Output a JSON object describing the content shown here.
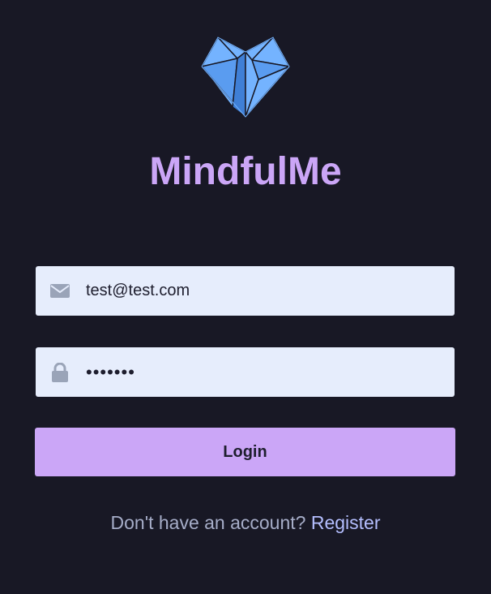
{
  "app": {
    "title": "MindfulMe",
    "logo_icon": "geometric-heart-icon"
  },
  "form": {
    "email": {
      "value": "test@test.com",
      "icon": "envelope-icon"
    },
    "password": {
      "value": "•••••••",
      "icon": "lock-icon"
    },
    "login_label": "Login"
  },
  "footer": {
    "prompt": "Don't have an account?",
    "register_label": "Register"
  },
  "colors": {
    "background": "#181825",
    "accent": "#cba6f7",
    "input_bg": "#e6edfc",
    "link": "#b4befe",
    "logo_blue": "#74b3ff"
  }
}
